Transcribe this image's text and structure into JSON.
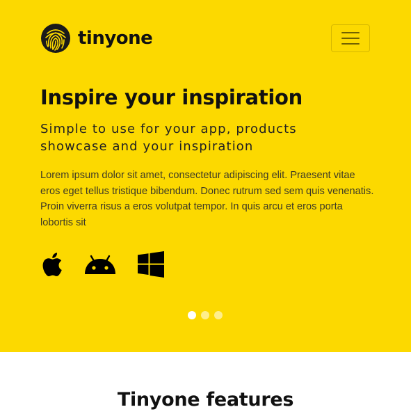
{
  "brand": {
    "name": "tinyone",
    "logo_icon": "fingerprint-icon"
  },
  "navbar": {
    "toggle_icon": "hamburger-menu-icon"
  },
  "hero": {
    "title": "Inspire your inspiration",
    "subtitle": "Simple to use for your app, products showcase and your inspiration",
    "body": "Lorem ipsum dolor sit amet, consectetur adipiscing elit. Praesent vitae eros eget tellus tristique bibendum. Donec rutrum sed sem quis venenatis. Proin viverra risus a eros volutpat tempor. In quis arcu et eros porta lobortis sit",
    "platforms": [
      "apple-icon",
      "android-icon",
      "windows-icon"
    ],
    "background_color": "#fcd900"
  },
  "carousel": {
    "slide_count": 3,
    "active_index": 0
  },
  "features": {
    "title": "Tinyone features"
  }
}
